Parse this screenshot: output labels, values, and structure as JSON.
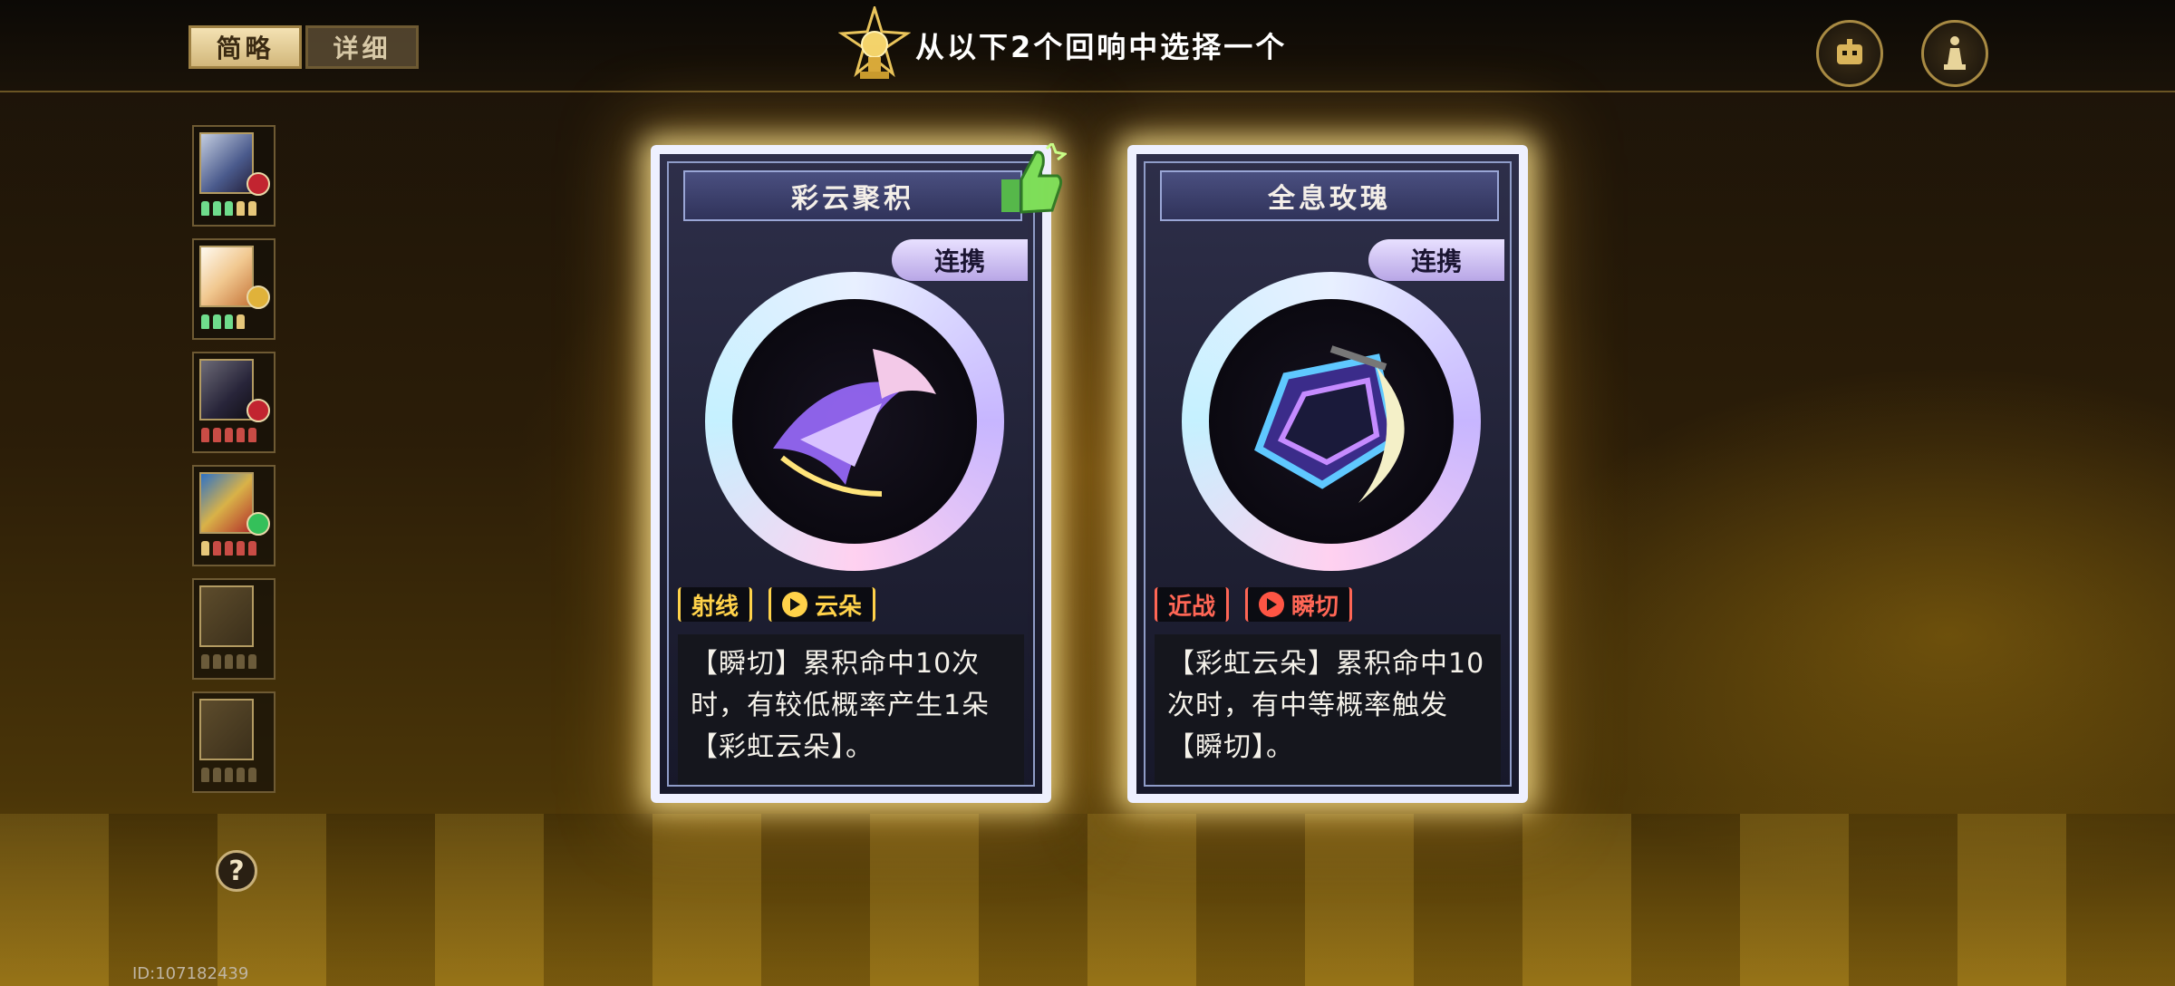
{
  "header": {
    "tabs": [
      {
        "label": "简略",
        "active": true
      },
      {
        "label": "详细",
        "active": false
      }
    ],
    "title": "从以下2个回响中选择一个",
    "right_icons": [
      "bot-icon",
      "chess-icon"
    ]
  },
  "team": {
    "slots": [
      {
        "badge": "red",
        "pips": [
          "#6fdc8c",
          "#6fdc8c",
          "#6fdc8c",
          "#e6c77a",
          "#e6c77a"
        ]
      },
      {
        "badge": "gold",
        "pips": [
          "#6fdc8c",
          "#6fdc8c",
          "#6fdc8c",
          "#e6c77a"
        ]
      },
      {
        "badge": "red",
        "pips": [
          "#c94c45",
          "#c94c45",
          "#c94c45",
          "#c94c45",
          "#c94c45"
        ]
      },
      {
        "badge": "green",
        "pips": [
          "#e6c77a",
          "#c94c45",
          "#c94c45",
          "#c94c45",
          "#c94c45"
        ]
      },
      {
        "badge": null,
        "pips": [
          "#6b5b3a",
          "#6b5b3a",
          "#6b5b3a",
          "#6b5b3a",
          "#6b5b3a"
        ]
      },
      {
        "badge": null,
        "pips": [
          "#6b5b3a",
          "#6b5b3a",
          "#6b5b3a",
          "#6b5b3a",
          "#6b5b3a"
        ]
      }
    ]
  },
  "help_label": "?",
  "uid": "ID:107182439",
  "cards": [
    {
      "name": "彩云聚积",
      "tag": "连携",
      "trait1": "射线",
      "trait2": "云朵",
      "description": "【瞬切】累积命中10次时，有较低概率产生1朵【彩虹云朵】。",
      "recommended": true
    },
    {
      "name": "全息玫瑰",
      "tag": "连携",
      "trait1": "近战",
      "trait2": "瞬切",
      "description": "【彩虹云朵】累积命中10次时，有中等概率触发【瞬切】。",
      "recommended": false
    }
  ],
  "colors": {
    "accent_gold": "#c8a24a",
    "card_frame": "#eef0ff"
  }
}
